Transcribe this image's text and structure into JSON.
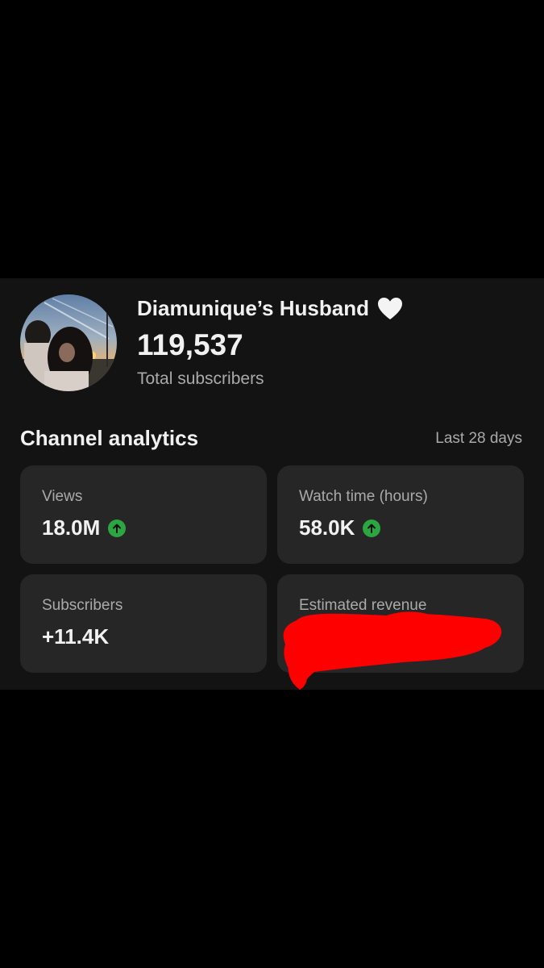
{
  "channel": {
    "name": "Diamunique’s Husband",
    "subscriber_count": "119,537",
    "subscriber_label": "Total subscribers"
  },
  "analytics": {
    "title": "Channel analytics",
    "period": "Last 28 days",
    "cards": [
      {
        "label": "Views",
        "value": "18.0M",
        "trend": "up"
      },
      {
        "label": "Watch time (hours)",
        "value": "58.0K",
        "trend": "up"
      },
      {
        "label": "Subscribers",
        "value": "+11.4K",
        "trend": "none"
      },
      {
        "label": "Estimated revenue",
        "value": "",
        "trend": "none",
        "redacted": true
      }
    ]
  },
  "colors": {
    "background": "#000000",
    "panel": "#131313",
    "card": "#262626",
    "trend_up": "#2ba640",
    "redaction": "#ff0000"
  },
  "icons": {
    "heart": "white-heart-icon",
    "trend_up": "arrow-up-circle-icon"
  }
}
